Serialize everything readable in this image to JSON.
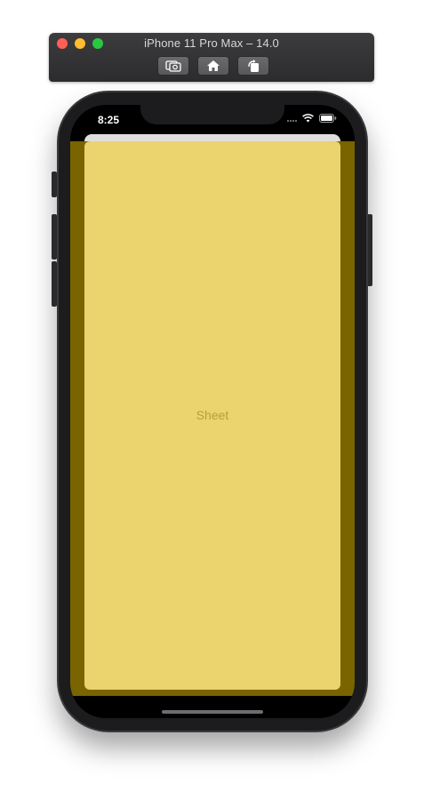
{
  "window": {
    "title": "iPhone 11 Pro Max – 14.0",
    "buttons": {
      "screenshot": "screenshot-icon",
      "home": "home-icon",
      "rotate": "rotate-icon"
    }
  },
  "status_bar": {
    "time": "8:25",
    "icons": [
      "signal-icon",
      "wifi-icon",
      "battery-icon"
    ]
  },
  "sheet": {
    "label": "Sheet",
    "background_color": "#ebd36d",
    "backdrop_color": "#7a6400"
  }
}
